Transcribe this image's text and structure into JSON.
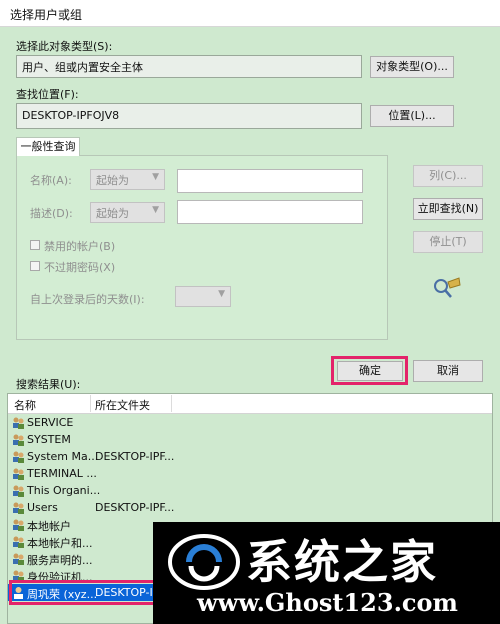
{
  "window": {
    "title": "选择用户或组"
  },
  "object_type": {
    "label": "选择此对象类型(S):",
    "value": "用户、组或内置安全主体",
    "button": "对象类型(O)..."
  },
  "location": {
    "label": "查找位置(F):",
    "value": "DESKTOP-IPFOJV8",
    "button": "位置(L)..."
  },
  "tab": {
    "label": "一般性查询"
  },
  "query": {
    "name_label": "名称(A):",
    "name_mode": "起始为",
    "desc_label": "描述(D):",
    "desc_mode": "起始为",
    "disabled_accounts": "禁用的帐户(B)",
    "non_expiring_pw": "不过期密码(X)",
    "days_label": "自上次登录后的天数(I):"
  },
  "side_buttons": {
    "columns": "列(C)...",
    "find_now": "立即查找(N)",
    "stop": "停止(T)"
  },
  "ok_button": "确定",
  "cancel_button": "取消",
  "results": {
    "label": "搜索结果(U):",
    "columns": [
      "名称",
      "所在文件夹"
    ],
    "rows": [
      {
        "name": "SERVICE",
        "folder": ""
      },
      {
        "name": "SYSTEM",
        "folder": ""
      },
      {
        "name": "System Ma...",
        "folder": "DESKTOP-IPF..."
      },
      {
        "name": "TERMINAL ...",
        "folder": ""
      },
      {
        "name": "This Organi...",
        "folder": ""
      },
      {
        "name": "Users",
        "folder": "DESKTOP-IPF..."
      },
      {
        "name": "本地帐户",
        "folder": ""
      },
      {
        "name": "本地帐户和...",
        "folder": ""
      },
      {
        "name": "服务声明的...",
        "folder": ""
      },
      {
        "name": "身份验证机...",
        "folder": ""
      },
      {
        "name": "周巩荣 (xyz...",
        "folder": "DESKTOP-IPF..."
      }
    ]
  },
  "watermark": {
    "brand": "系统之家",
    "url": "www.Ghost123.com"
  },
  "colors": {
    "highlight": "#e3246a",
    "selection": "#0a64d8",
    "background": "#cfe9cf"
  }
}
